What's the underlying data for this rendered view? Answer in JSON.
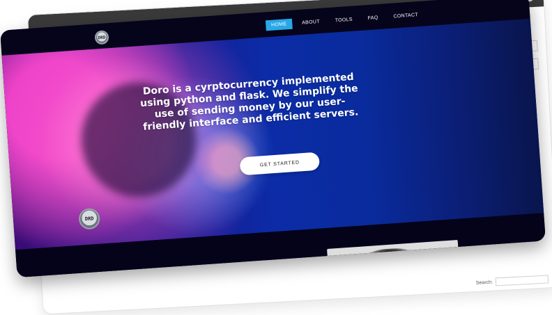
{
  "navbar": {
    "logo_text": "DRD",
    "items": [
      {
        "label": "HOME",
        "active": true
      },
      {
        "label": "ABOUT",
        "active": false
      },
      {
        "label": "TOOLS",
        "active": false
      },
      {
        "label": "FAQ",
        "active": false
      },
      {
        "label": "CONTACT",
        "active": false
      }
    ]
  },
  "hero": {
    "headline": "Doro is a cyrptocurrency implemented using python and flask. We simplify the use of sending money by our user-friendly interface and efficient servers.",
    "cta_label": "GET STARTED",
    "badge_text": "DRD"
  },
  "back_window": {
    "search_label": "Search:"
  },
  "colors": {
    "nav_active": "#29a8e8",
    "page_bg": "#05031a",
    "hero_blue": "#0b2ca6",
    "hero_pink": "#ff5fcd"
  },
  "icons": {
    "user": "user-icon",
    "logo": "doro-logo-icon"
  }
}
